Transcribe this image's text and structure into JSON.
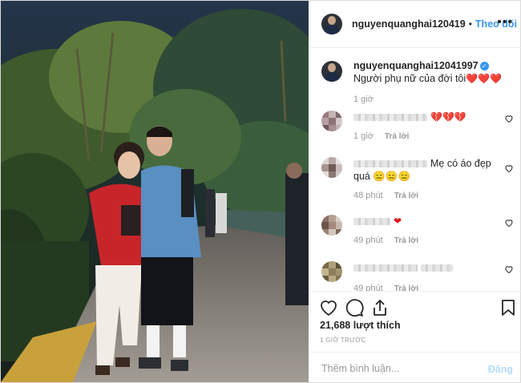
{
  "post": {
    "username": "nguyenquanghai120419",
    "follow_label": "Theo dõi",
    "more_label": "•••",
    "dot": "•"
  },
  "caption": {
    "username": "nguyenquanghai12041997",
    "text": "Người phụ nữ của đời tôi",
    "hearts": "❤️❤️❤️",
    "time": "1 giờ"
  },
  "comments": [
    {
      "text": "",
      "hearts": "💔💔💔",
      "time": "1 giờ",
      "reply_label": "Trả lời"
    },
    {
      "text": "Mẹ có áo đẹp quá",
      "emoji": "😑😑😑",
      "time": "48 phút",
      "reply_label": "Trả lời"
    },
    {
      "text": "",
      "hearts": "❤",
      "time": "49 phút",
      "reply_label": "Trả lời"
    },
    {
      "text": "",
      "time": "49 phút",
      "reply_label": "Trả lời"
    }
  ],
  "stats": {
    "likes": "21,688 lượt thích",
    "posted": "1 GIỜ TRƯỚC"
  },
  "add_comment": {
    "placeholder": "Thêm bình luận...",
    "post_label": "Đăng"
  },
  "colors": {
    "accent": "#3897f0",
    "heart": "#e0191f"
  },
  "icons": [
    "heart-icon",
    "comment-icon",
    "share-icon",
    "bookmark-icon",
    "verified-icon",
    "more-icon"
  ]
}
